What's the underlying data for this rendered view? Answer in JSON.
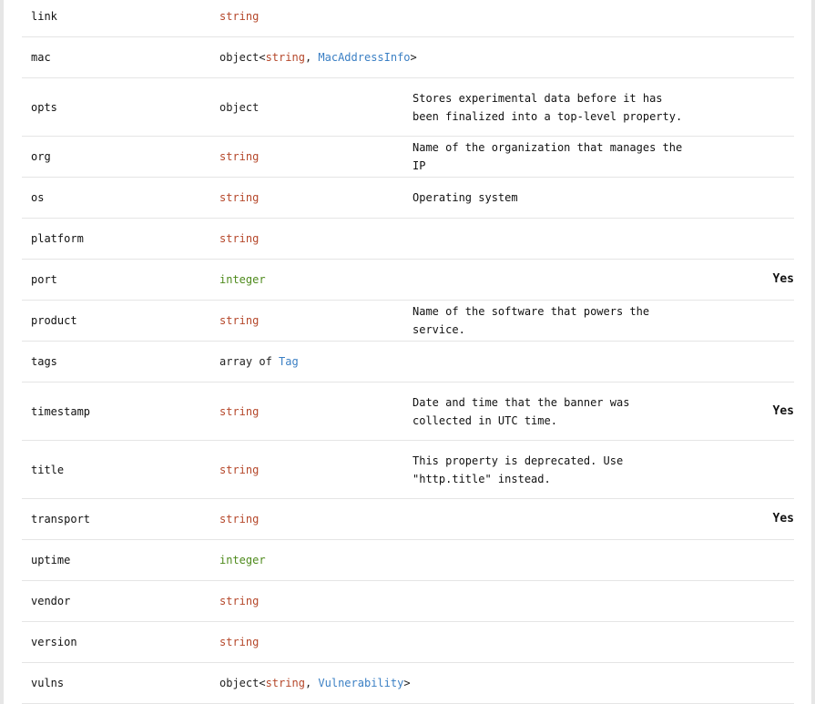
{
  "rows": [
    {
      "name": "link",
      "type_parts": [
        {
          "text": "string",
          "kind": "string"
        }
      ],
      "description": "",
      "required": ""
    },
    {
      "name": "mac",
      "type_parts": [
        {
          "text": "object<",
          "kind": "plain"
        },
        {
          "text": "string",
          "kind": "string"
        },
        {
          "text": ", ",
          "kind": "plain"
        },
        {
          "text": "MacAddressInfo",
          "kind": "link"
        },
        {
          "text": ">",
          "kind": "plain"
        }
      ],
      "description": "",
      "required": ""
    },
    {
      "name": "opts",
      "type_parts": [
        {
          "text": "object",
          "kind": "plain"
        }
      ],
      "description": "Stores experimental data before it has been finalized into a top-level property.",
      "required": ""
    },
    {
      "name": "org",
      "type_parts": [
        {
          "text": "string",
          "kind": "string"
        }
      ],
      "description": "Name of the organization that manages the IP",
      "required": ""
    },
    {
      "name": "os",
      "type_parts": [
        {
          "text": "string",
          "kind": "string"
        }
      ],
      "description": "Operating system",
      "required": ""
    },
    {
      "name": "platform",
      "type_parts": [
        {
          "text": "string",
          "kind": "string"
        }
      ],
      "description": "",
      "required": ""
    },
    {
      "name": "port",
      "type_parts": [
        {
          "text": "integer",
          "kind": "integer"
        }
      ],
      "description": "",
      "required": "Yes"
    },
    {
      "name": "product",
      "type_parts": [
        {
          "text": "string",
          "kind": "string"
        }
      ],
      "description": "Name of the software that powers the service.",
      "required": ""
    },
    {
      "name": "tags",
      "type_parts": [
        {
          "text": "array of ",
          "kind": "plain"
        },
        {
          "text": "Tag",
          "kind": "link"
        }
      ],
      "description": "",
      "required": ""
    },
    {
      "name": "timestamp",
      "type_parts": [
        {
          "text": "string",
          "kind": "string"
        }
      ],
      "description": "Date and time that the banner was collected in UTC time.",
      "required": "Yes"
    },
    {
      "name": "title",
      "type_parts": [
        {
          "text": "string",
          "kind": "string"
        }
      ],
      "description": "This property is deprecated. Use \"http.title\" instead.",
      "required": ""
    },
    {
      "name": "transport",
      "type_parts": [
        {
          "text": "string",
          "kind": "string"
        }
      ],
      "description": "",
      "required": "Yes"
    },
    {
      "name": "uptime",
      "type_parts": [
        {
          "text": "integer",
          "kind": "integer"
        }
      ],
      "description": "",
      "required": ""
    },
    {
      "name": "vendor",
      "type_parts": [
        {
          "text": "string",
          "kind": "string"
        }
      ],
      "description": "",
      "required": ""
    },
    {
      "name": "version",
      "type_parts": [
        {
          "text": "string",
          "kind": "string"
        }
      ],
      "description": "",
      "required": ""
    },
    {
      "name": "vulns",
      "type_parts": [
        {
          "text": "object<",
          "kind": "plain"
        },
        {
          "text": "string",
          "kind": "string"
        },
        {
          "text": ", ",
          "kind": "plain"
        },
        {
          "text": "Vulnerability",
          "kind": "link"
        },
        {
          "text": ">",
          "kind": "plain"
        }
      ],
      "description": "",
      "required": ""
    }
  ],
  "colors": {
    "string": "#b5472a",
    "integer": "#4e8a1c",
    "link": "#3a7fc4",
    "divider": "#e5e5e5"
  }
}
